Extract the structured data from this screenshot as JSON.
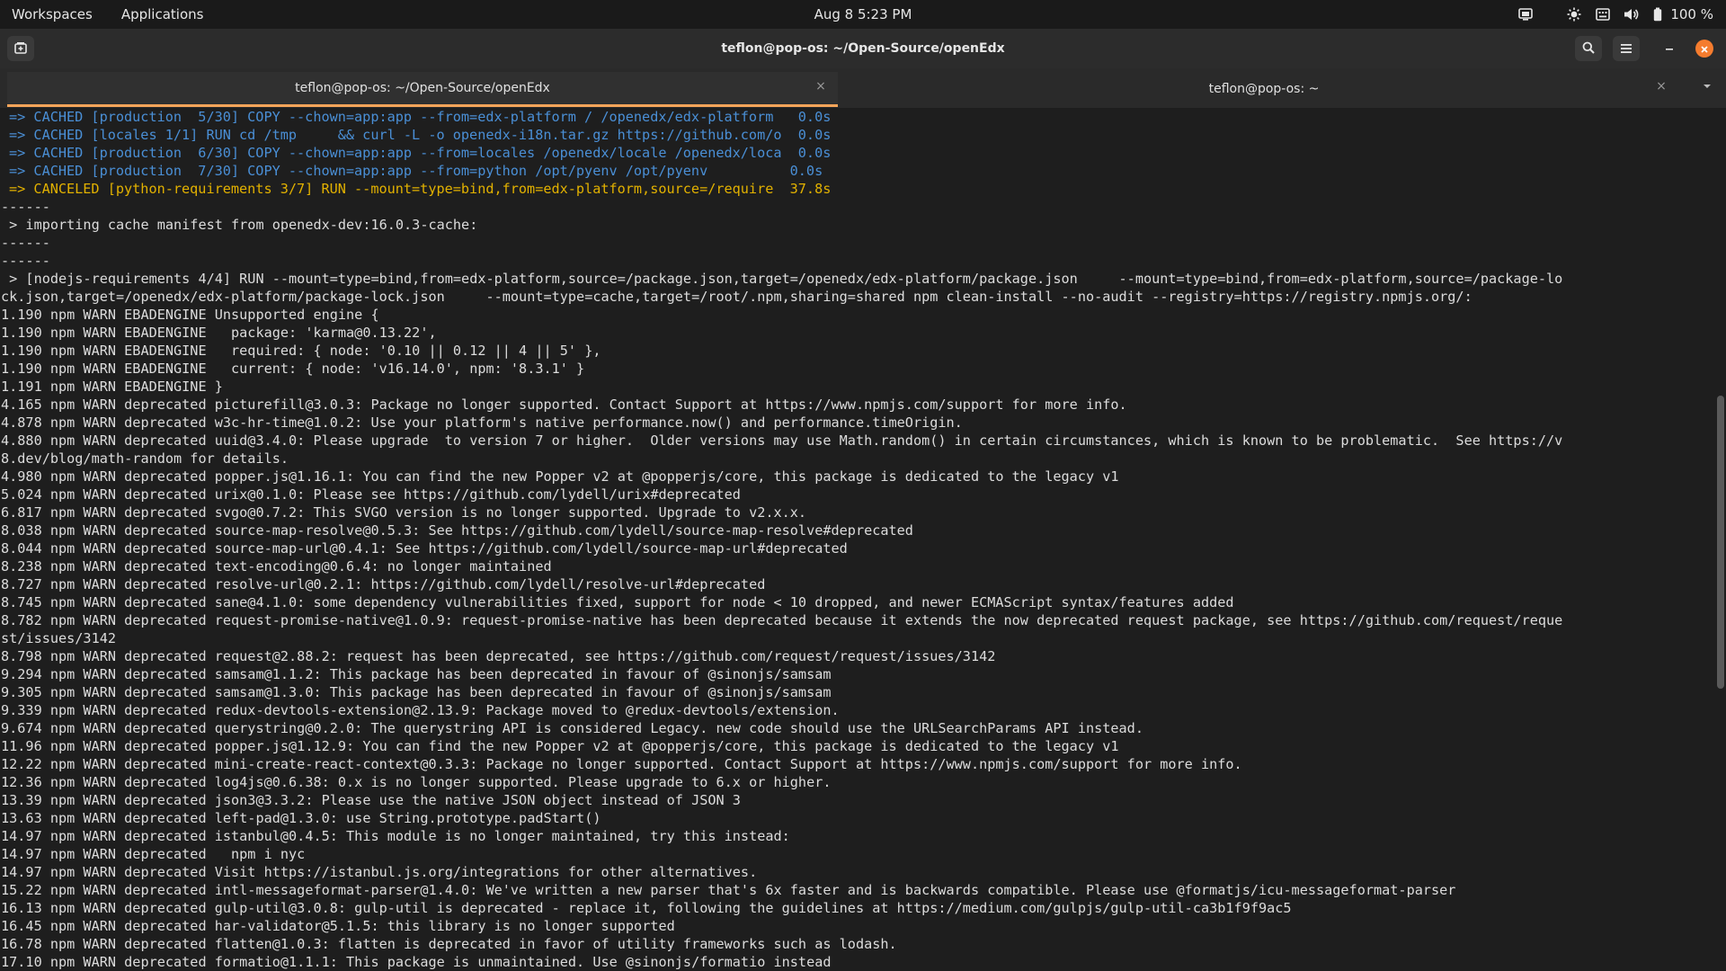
{
  "topbar": {
    "workspaces": "Workspaces",
    "applications": "Applications",
    "clock": "Aug 8   5:23 PM",
    "battery": "100 %"
  },
  "window": {
    "title": "teflon@pop-os: ~/Open-Source/openEdx"
  },
  "tabs": [
    {
      "label": "teflon@pop-os: ~/Open-Source/openEdx",
      "active": true
    },
    {
      "label": "teflon@pop-os: ~",
      "active": false
    }
  ],
  "terminal": {
    "lines": [
      {
        "text": "=> CACHED [production  5/30] COPY --chown=app:app --from=edx-platform / /openedx/edx-platform   0.0s",
        "style": "blue"
      },
      {
        "text": "=> CACHED [locales 1/1] RUN cd /tmp     && curl -L -o openedx-i18n.tar.gz https://github.com/o  0.0s",
        "style": "blue"
      },
      {
        "text": "=> CACHED [production  6/30] COPY --chown=app:app --from=locales /openedx/locale /openedx/loca  0.0s",
        "style": "blue"
      },
      {
        "text": "=> CACHED [production  7/30] COPY --chown=app:app --from=python /opt/pyenv /opt/pyenv          0.0s",
        "style": "blue"
      },
      {
        "text": "=> CANCELED [python-requirements 3/7] RUN --mount=type=bind,from=edx-platform,source=/require  37.8s",
        "style": "yellow"
      },
      {
        "text": "------",
        "style": "plain"
      },
      {
        "text": " > importing cache manifest from openedx-dev:16.0.3-cache:",
        "style": "plain"
      },
      {
        "text": "------",
        "style": "plain"
      },
      {
        "text": "------",
        "style": "plain"
      },
      {
        "text": " > [nodejs-requirements 4/4] RUN --mount=type=bind,from=edx-platform,source=/package.json,target=/openedx/edx-platform/package.json     --mount=type=bind,from=edx-platform,source=/package-lo",
        "style": "plain"
      },
      {
        "text": "ck.json,target=/openedx/edx-platform/package-lock.json     --mount=type=cache,target=/root/.npm,sharing=shared npm clean-install --no-audit --registry=https://registry.npmjs.org/:",
        "style": "plain"
      },
      {
        "text": "1.190 npm WARN EBADENGINE Unsupported engine {",
        "style": "plain"
      },
      {
        "text": "1.190 npm WARN EBADENGINE   package: 'karma@0.13.22',",
        "style": "plain"
      },
      {
        "text": "1.190 npm WARN EBADENGINE   required: { node: '0.10 || 0.12 || 4 || 5' },",
        "style": "plain"
      },
      {
        "text": "1.190 npm WARN EBADENGINE   current: { node: 'v16.14.0', npm: '8.3.1' }",
        "style": "plain"
      },
      {
        "text": "1.191 npm WARN EBADENGINE }",
        "style": "plain"
      },
      {
        "text": "4.165 npm WARN deprecated picturefill@3.0.3: Package no longer supported. Contact Support at https://www.npmjs.com/support for more info.",
        "style": "plain"
      },
      {
        "text": "4.878 npm WARN deprecated w3c-hr-time@1.0.2: Use your platform's native performance.now() and performance.timeOrigin.",
        "style": "plain"
      },
      {
        "text": "4.880 npm WARN deprecated uuid@3.4.0: Please upgrade  to version 7 or higher.  Older versions may use Math.random() in certain circumstances, which is known to be problematic.  See https://v",
        "style": "plain"
      },
      {
        "text": "8.dev/blog/math-random for details.",
        "style": "plain"
      },
      {
        "text": "4.980 npm WARN deprecated popper.js@1.16.1: You can find the new Popper v2 at @popperjs/core, this package is dedicated to the legacy v1",
        "style": "plain"
      },
      {
        "text": "5.024 npm WARN deprecated urix@0.1.0: Please see https://github.com/lydell/urix#deprecated",
        "style": "plain"
      },
      {
        "text": "6.817 npm WARN deprecated svgo@0.7.2: This SVGO version is no longer supported. Upgrade to v2.x.x.",
        "style": "plain"
      },
      {
        "text": "8.038 npm WARN deprecated source-map-resolve@0.5.3: See https://github.com/lydell/source-map-resolve#deprecated",
        "style": "plain"
      },
      {
        "text": "8.044 npm WARN deprecated source-map-url@0.4.1: See https://github.com/lydell/source-map-url#deprecated",
        "style": "plain"
      },
      {
        "text": "8.238 npm WARN deprecated text-encoding@0.6.4: no longer maintained",
        "style": "plain"
      },
      {
        "text": "8.727 npm WARN deprecated resolve-url@0.2.1: https://github.com/lydell/resolve-url#deprecated",
        "style": "plain"
      },
      {
        "text": "8.745 npm WARN deprecated sane@4.1.0: some dependency vulnerabilities fixed, support for node < 10 dropped, and newer ECMAScript syntax/features added",
        "style": "plain"
      },
      {
        "text": "8.782 npm WARN deprecated request-promise-native@1.0.9: request-promise-native has been deprecated because it extends the now deprecated request package, see https://github.com/request/reque",
        "style": "plain"
      },
      {
        "text": "st/issues/3142",
        "style": "plain"
      },
      {
        "text": "8.798 npm WARN deprecated request@2.88.2: request has been deprecated, see https://github.com/request/request/issues/3142",
        "style": "plain"
      },
      {
        "text": "9.294 npm WARN deprecated samsam@1.1.2: This package has been deprecated in favour of @sinonjs/samsam",
        "style": "plain"
      },
      {
        "text": "9.305 npm WARN deprecated samsam@1.3.0: This package has been deprecated in favour of @sinonjs/samsam",
        "style": "plain"
      },
      {
        "text": "9.339 npm WARN deprecated redux-devtools-extension@2.13.9: Package moved to @redux-devtools/extension.",
        "style": "plain"
      },
      {
        "text": "9.674 npm WARN deprecated querystring@0.2.0: The querystring API is considered Legacy. new code should use the URLSearchParams API instead.",
        "style": "plain"
      },
      {
        "text": "11.96 npm WARN deprecated popper.js@1.12.9: You can find the new Popper v2 at @popperjs/core, this package is dedicated to the legacy v1",
        "style": "plain"
      },
      {
        "text": "12.22 npm WARN deprecated mini-create-react-context@0.3.3: Package no longer supported. Contact Support at https://www.npmjs.com/support for more info.",
        "style": "plain"
      },
      {
        "text": "12.36 npm WARN deprecated log4js@0.6.38: 0.x is no longer supported. Please upgrade to 6.x or higher.",
        "style": "plain"
      },
      {
        "text": "13.39 npm WARN deprecated json3@3.3.2: Please use the native JSON object instead of JSON 3",
        "style": "plain"
      },
      {
        "text": "13.63 npm WARN deprecated left-pad@1.3.0: use String.prototype.padStart()",
        "style": "plain"
      },
      {
        "text": "14.97 npm WARN deprecated istanbul@0.4.5: This module is no longer maintained, try this instead:",
        "style": "plain"
      },
      {
        "text": "14.97 npm WARN deprecated   npm i nyc",
        "style": "plain"
      },
      {
        "text": "14.97 npm WARN deprecated Visit https://istanbul.js.org/integrations for other alternatives.",
        "style": "plain"
      },
      {
        "text": "15.22 npm WARN deprecated intl-messageformat-parser@1.4.0: We've written a new parser that's 6x faster and is backwards compatible. Please use @formatjs/icu-messageformat-parser",
        "style": "plain"
      },
      {
        "text": "16.13 npm WARN deprecated gulp-util@3.0.8: gulp-util is deprecated - replace it, following the guidelines at https://medium.com/gulpjs/gulp-util-ca3b1f9f9ac5",
        "style": "plain"
      },
      {
        "text": "16.45 npm WARN deprecated har-validator@5.1.5: this library is no longer supported",
        "style": "plain"
      },
      {
        "text": "16.78 npm WARN deprecated flatten@1.0.3: flatten is deprecated in favor of utility frameworks such as lodash.",
        "style": "plain"
      },
      {
        "text": "17.10 npm WARN deprecated formatio@1.1.1: This package is unmaintained. Use @sinonjs/formatio instead",
        "style": "plain"
      }
    ]
  },
  "colors": {
    "accent_close": "#f57c2e",
    "tab_indicator": "#f9a55a",
    "cached_text": "#4a8fd6",
    "canceled_text": "#e2b100"
  },
  "icons": {
    "new_tab": "new-tab-icon",
    "search": "search-icon",
    "menu": "hamburger-menu-icon",
    "minimize": "minimize-icon",
    "close": "close-icon",
    "tray": [
      "screen-share-icon",
      "brightness-icon",
      "keyboard-icon",
      "volume-icon",
      "battery-icon"
    ]
  }
}
